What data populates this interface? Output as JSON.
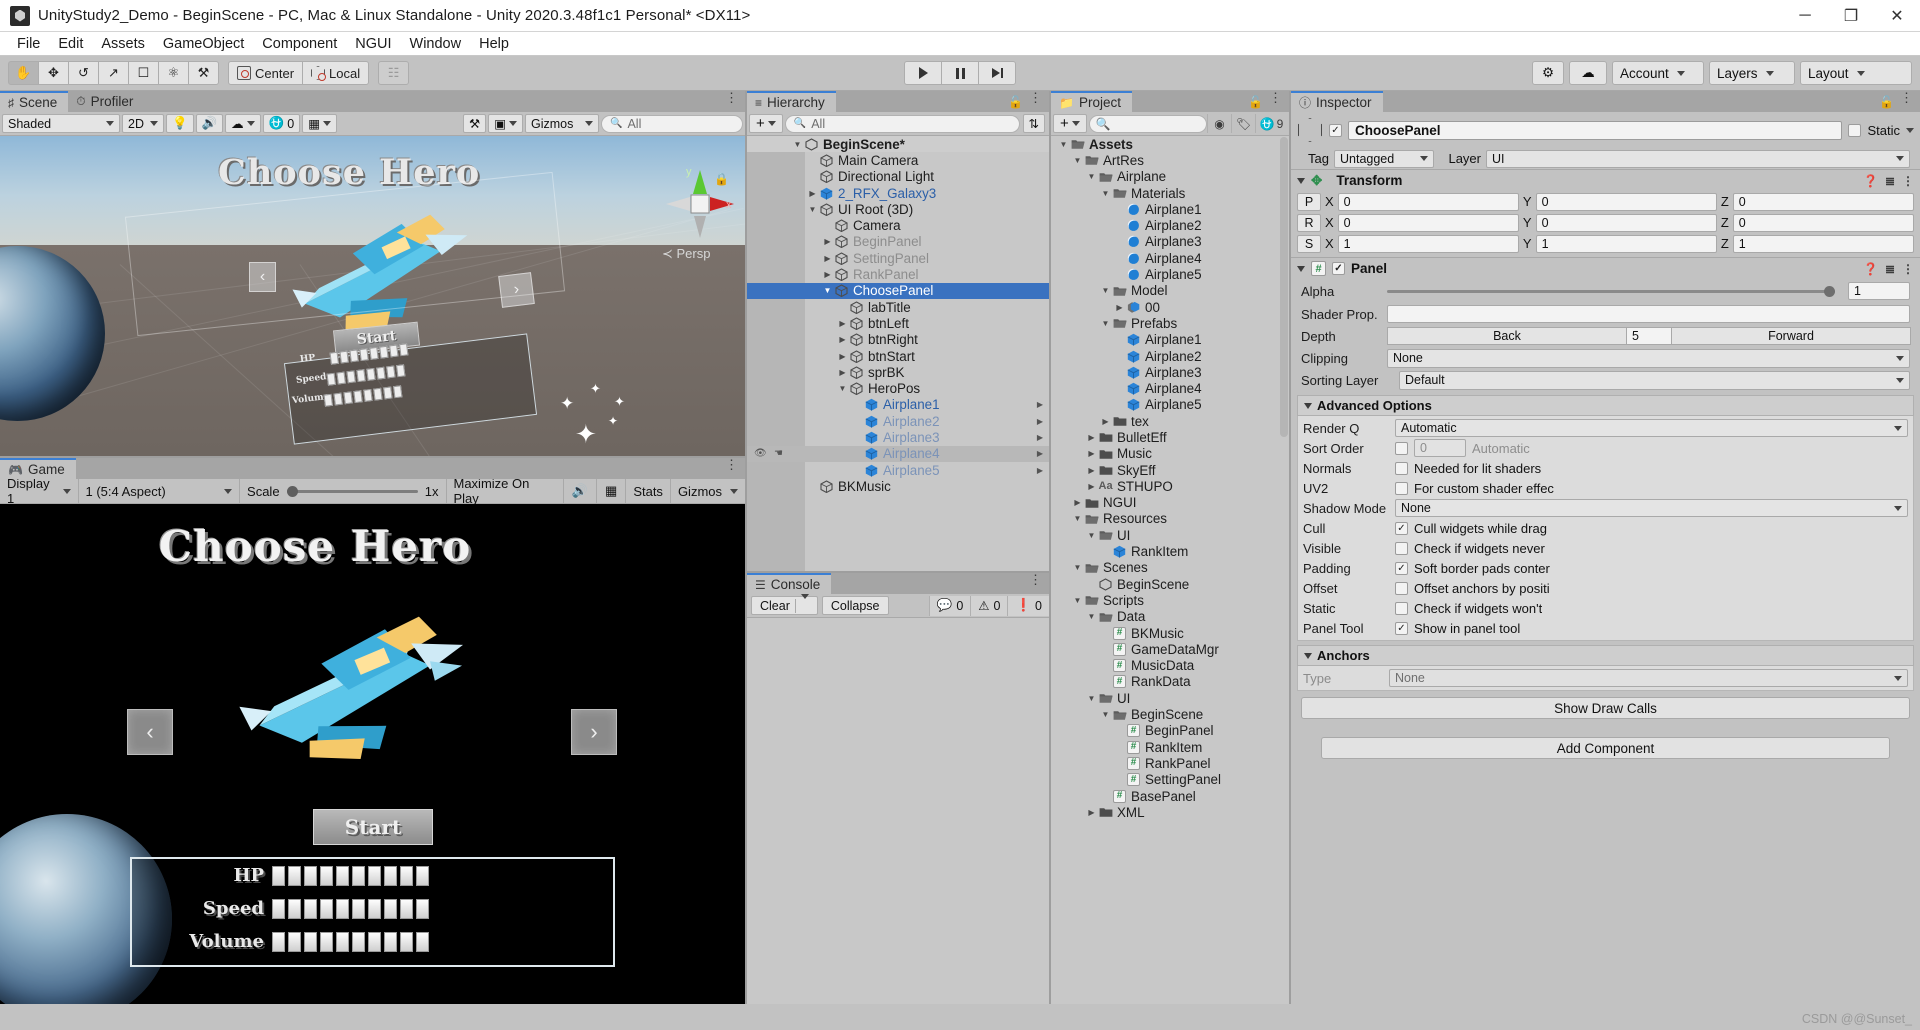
{
  "window": {
    "title": "UnityStudy2_Demo - BeginScene - PC, Mac & Linux Standalone - Unity 2020.3.48f1c1 Personal* <DX11>",
    "minimize": "─",
    "maximize": "❐",
    "close": "✕"
  },
  "menu": [
    "File",
    "Edit",
    "Assets",
    "GameObject",
    "Component",
    "NGUI",
    "Window",
    "Help"
  ],
  "toolbar": {
    "tools": [
      "hand-tool",
      "move-tool",
      "rotate-tool",
      "scale-tool",
      "rect-tool",
      "transform-tool",
      "custom-tool"
    ],
    "pivot_label": "Center",
    "space_label": "Local",
    "play": "▶",
    "pause": "⏸",
    "step": "⏭",
    "cloud": "cloud-icon",
    "settings": "gear-icon",
    "account": "Account",
    "layers": "Layers",
    "layout": "Layout"
  },
  "scene": {
    "tab": "Scene",
    "tab2": "Profiler",
    "shading": "Shaded",
    "mode2d": "2D",
    "gizmos": "Gizmos",
    "search_placeholder": "All",
    "overlay_title": "Choose Hero",
    "persp": "Persp",
    "axis_y": "y",
    "axis_x": "x",
    "start_label": "Start",
    "stat_hp": "HP",
    "stat_speed": "Speed",
    "stat_volume": "Volume",
    "left_arrow": "‹",
    "right_arrow": "›"
  },
  "game": {
    "tab": "Game",
    "display": "Display 1",
    "aspect": "1 (5:4 Aspect)",
    "scale_label": "Scale",
    "scale_value": "1x",
    "maximize": "Maximize On Play",
    "mute": "mute-audio-icon",
    "stats": "Stats",
    "gizmos": "Gizmos",
    "title": "Choose Hero",
    "left_arrow": "‹",
    "right_arrow": "›",
    "start_label": "Start",
    "stats_rows": [
      {
        "label": "HP",
        "filled": 10
      },
      {
        "label": "Speed",
        "filled": 10
      },
      {
        "label": "Volume",
        "filled": 10
      }
    ]
  },
  "hierarchy": {
    "tab": "Hierarchy",
    "add_label": "+",
    "search_placeholder": "All",
    "items": [
      {
        "label": "BeginScene*",
        "indent": 0,
        "arrow": "down",
        "icon": "unity-scene-icon",
        "style": "scene-header"
      },
      {
        "label": "Main Camera",
        "indent": 1,
        "arrow": "none",
        "icon": "gameobject-icon",
        "style": "normal"
      },
      {
        "label": "Directional Light",
        "indent": 1,
        "arrow": "none",
        "icon": "gameobject-icon",
        "style": "normal"
      },
      {
        "label": "2_RFX_Galaxy3",
        "indent": 1,
        "arrow": "right",
        "icon": "prefab-icon",
        "style": "prefab"
      },
      {
        "label": "UI Root (3D)",
        "indent": 1,
        "arrow": "down",
        "icon": "gameobject-icon",
        "style": "normal"
      },
      {
        "label": "Camera",
        "indent": 2,
        "arrow": "none",
        "icon": "gameobject-icon",
        "style": "normal"
      },
      {
        "label": "BeginPanel",
        "indent": 2,
        "arrow": "right",
        "icon": "gameobject-icon",
        "style": "disabled"
      },
      {
        "label": "SettingPanel",
        "indent": 2,
        "arrow": "right",
        "icon": "gameobject-icon",
        "style": "disabled"
      },
      {
        "label": "RankPanel",
        "indent": 2,
        "arrow": "right",
        "icon": "gameobject-icon",
        "style": "disabled"
      },
      {
        "label": "ChoosePanel",
        "indent": 2,
        "arrow": "down",
        "icon": "gameobject-icon",
        "style": "selected"
      },
      {
        "label": "labTitle",
        "indent": 3,
        "arrow": "none",
        "icon": "gameobject-icon",
        "style": "normal"
      },
      {
        "label": "btnLeft",
        "indent": 3,
        "arrow": "right",
        "icon": "gameobject-icon",
        "style": "normal"
      },
      {
        "label": "btnRight",
        "indent": 3,
        "arrow": "right",
        "icon": "gameobject-icon",
        "style": "normal"
      },
      {
        "label": "btnStart",
        "indent": 3,
        "arrow": "right",
        "icon": "gameobject-icon",
        "style": "normal"
      },
      {
        "label": "sprBK",
        "indent": 3,
        "arrow": "right",
        "icon": "gameobject-icon",
        "style": "normal"
      },
      {
        "label": "HeroPos",
        "indent": 3,
        "arrow": "down",
        "icon": "gameobject-icon",
        "style": "normal"
      },
      {
        "label": "Airplane1",
        "indent": 4,
        "arrow": "none",
        "icon": "prefab-icon",
        "style": "prefab",
        "expand": true
      },
      {
        "label": "Airplane2",
        "indent": 4,
        "arrow": "none",
        "icon": "prefab-icon",
        "style": "prefab-disabled",
        "expand": true
      },
      {
        "label": "Airplane3",
        "indent": 4,
        "arrow": "none",
        "icon": "prefab-icon",
        "style": "prefab-disabled",
        "expand": true
      },
      {
        "label": "Airplane4",
        "indent": 4,
        "arrow": "none",
        "icon": "prefab-icon",
        "style": "prefab-disabled-hover",
        "expand": true
      },
      {
        "label": "Airplane5",
        "indent": 4,
        "arrow": "none",
        "icon": "prefab-icon",
        "style": "prefab-disabled",
        "expand": true
      },
      {
        "label": "BKMusic",
        "indent": 1,
        "arrow": "none",
        "icon": "gameobject-icon",
        "style": "normal"
      }
    ]
  },
  "console": {
    "tab": "Console",
    "clear": "Clear",
    "collapse": "Collapse",
    "log_count": "0",
    "warn_count": "0",
    "error_count": "0"
  },
  "project": {
    "tab": "Project",
    "add_label": "+",
    "search_placeholder": "",
    "hidden_count": "9",
    "items": [
      {
        "label": "Assets",
        "indent": 0,
        "arrow": "down",
        "icon": "folder-open-icon",
        "bold": true
      },
      {
        "label": "ArtRes",
        "indent": 1,
        "arrow": "down",
        "icon": "folder-open-icon"
      },
      {
        "label": "Airplane",
        "indent": 2,
        "arrow": "down",
        "icon": "folder-open-icon"
      },
      {
        "label": "Materials",
        "indent": 3,
        "arrow": "down",
        "icon": "folder-open-icon"
      },
      {
        "label": "Airplane1",
        "indent": 4,
        "arrow": "none",
        "icon": "material-icon"
      },
      {
        "label": "Airplane2",
        "indent": 4,
        "arrow": "none",
        "icon": "material-icon"
      },
      {
        "label": "Airplane3",
        "indent": 4,
        "arrow": "none",
        "icon": "material-icon"
      },
      {
        "label": "Airplane4",
        "indent": 4,
        "arrow": "none",
        "icon": "material-icon"
      },
      {
        "label": "Airplane5",
        "indent": 4,
        "arrow": "none",
        "icon": "material-icon"
      },
      {
        "label": "Model",
        "indent": 3,
        "arrow": "down",
        "icon": "folder-open-icon"
      },
      {
        "label": "00",
        "indent": 4,
        "arrow": "right",
        "icon": "model-icon"
      },
      {
        "label": "Prefabs",
        "indent": 3,
        "arrow": "down",
        "icon": "folder-open-icon"
      },
      {
        "label": "Airplane1",
        "indent": 4,
        "arrow": "none",
        "icon": "prefab-icon"
      },
      {
        "label": "Airplane2",
        "indent": 4,
        "arrow": "none",
        "icon": "prefab-icon"
      },
      {
        "label": "Airplane3",
        "indent": 4,
        "arrow": "none",
        "icon": "prefab-icon"
      },
      {
        "label": "Airplane4",
        "indent": 4,
        "arrow": "none",
        "icon": "prefab-icon"
      },
      {
        "label": "Airplane5",
        "indent": 4,
        "arrow": "none",
        "icon": "prefab-icon"
      },
      {
        "label": "tex",
        "indent": 3,
        "arrow": "right",
        "icon": "folder-icon"
      },
      {
        "label": "BulletEff",
        "indent": 2,
        "arrow": "right",
        "icon": "folder-icon"
      },
      {
        "label": "Music",
        "indent": 2,
        "arrow": "right",
        "icon": "folder-icon"
      },
      {
        "label": "SkyEff",
        "indent": 2,
        "arrow": "right",
        "icon": "folder-icon"
      },
      {
        "label": "STHUPO",
        "indent": 2,
        "arrow": "right",
        "icon": "font-icon"
      },
      {
        "label": "NGUI",
        "indent": 1,
        "arrow": "right",
        "icon": "folder-icon"
      },
      {
        "label": "Resources",
        "indent": 1,
        "arrow": "down",
        "icon": "folder-open-icon"
      },
      {
        "label": "UI",
        "indent": 2,
        "arrow": "down",
        "icon": "folder-open-icon"
      },
      {
        "label": "RankItem",
        "indent": 3,
        "arrow": "none",
        "icon": "prefab-icon"
      },
      {
        "label": "Scenes",
        "indent": 1,
        "arrow": "down",
        "icon": "folder-open-icon"
      },
      {
        "label": "BeginScene",
        "indent": 2,
        "arrow": "none",
        "icon": "unity-scene-icon"
      },
      {
        "label": "Scripts",
        "indent": 1,
        "arrow": "down",
        "icon": "folder-open-icon"
      },
      {
        "label": "Data",
        "indent": 2,
        "arrow": "down",
        "icon": "folder-open-icon"
      },
      {
        "label": "BKMusic",
        "indent": 3,
        "arrow": "none",
        "icon": "script-icon"
      },
      {
        "label": "GameDataMgr",
        "indent": 3,
        "arrow": "none",
        "icon": "script-icon"
      },
      {
        "label": "MusicData",
        "indent": 3,
        "arrow": "none",
        "icon": "script-icon"
      },
      {
        "label": "RankData",
        "indent": 3,
        "arrow": "none",
        "icon": "script-icon"
      },
      {
        "label": "UI",
        "indent": 2,
        "arrow": "down",
        "icon": "folder-open-icon"
      },
      {
        "label": "BeginScene",
        "indent": 3,
        "arrow": "down",
        "icon": "folder-open-icon"
      },
      {
        "label": "BeginPanel",
        "indent": 4,
        "arrow": "none",
        "icon": "script-icon"
      },
      {
        "label": "RankItem",
        "indent": 4,
        "arrow": "none",
        "icon": "script-icon"
      },
      {
        "label": "RankPanel",
        "indent": 4,
        "arrow": "none",
        "icon": "script-icon"
      },
      {
        "label": "SettingPanel",
        "indent": 4,
        "arrow": "none",
        "icon": "script-icon"
      },
      {
        "label": "BasePanel",
        "indent": 3,
        "arrow": "none",
        "icon": "script-icon"
      },
      {
        "label": "XML",
        "indent": 2,
        "arrow": "right",
        "icon": "folder-icon"
      }
    ]
  },
  "inspector": {
    "tab": "Inspector",
    "object_name": "ChoosePanel",
    "enabled": true,
    "static_label": "Static",
    "tag_label": "Tag",
    "tag_value": "Untagged",
    "layer_label": "Layer",
    "layer_value": "UI",
    "transform": {
      "title": "Transform",
      "rows": [
        {
          "key": "P",
          "x": "0",
          "y": "0",
          "z": "0"
        },
        {
          "key": "R",
          "x": "0",
          "y": "0",
          "z": "0"
        },
        {
          "key": "S",
          "x": "1",
          "y": "1",
          "z": "1"
        }
      ],
      "axis_x": "X",
      "axis_y": "Y",
      "axis_z": "Z"
    },
    "panel": {
      "title": "Panel",
      "alpha_label": "Alpha",
      "alpha_value": "1",
      "shader_label": "Shader Prop.",
      "shader_value": "",
      "depth_label": "Depth",
      "depth_back": "Back",
      "depth_value": "5",
      "depth_forward": "Forward",
      "clipping_label": "Clipping",
      "clipping_value": "None",
      "sorting_label": "Sorting Layer",
      "sorting_value": "Default",
      "advanced_title": "Advanced Options",
      "advanced": [
        {
          "label": "Render Q",
          "type": "dropdown",
          "value": "Automatic"
        },
        {
          "label": "Sort Order",
          "type": "check-field",
          "checked": false,
          "field": "0",
          "value": "Automatic"
        },
        {
          "label": "Normals",
          "type": "checkbox",
          "checked": false,
          "value": "Needed for lit shaders"
        },
        {
          "label": "UV2",
          "type": "checkbox",
          "checked": false,
          "value": "For custom shader effec"
        },
        {
          "label": "Shadow Mode",
          "type": "dropdown",
          "value": "None"
        },
        {
          "label": "Cull",
          "type": "checkbox",
          "checked": true,
          "value": "Cull widgets while drag"
        },
        {
          "label": "Visible",
          "type": "checkbox",
          "checked": false,
          "value": "Check if widgets never"
        },
        {
          "label": "Padding",
          "type": "checkbox",
          "checked": true,
          "value": "Soft border pads conter"
        },
        {
          "label": "Offset",
          "type": "checkbox",
          "checked": false,
          "value": "Offset anchors by positi"
        },
        {
          "label": "Static",
          "type": "checkbox",
          "checked": false,
          "value": "Check if widgets won't"
        },
        {
          "label": "Panel Tool",
          "type": "checkbox",
          "checked": true,
          "value": "Show in panel tool"
        }
      ],
      "anchors_title": "Anchors",
      "anchors_type_label": "Type",
      "anchors_type_value": "None",
      "show_draw_calls": "Show Draw Calls"
    },
    "add_component": "Add Component"
  },
  "watermark": "CSDN @@Sunset_"
}
